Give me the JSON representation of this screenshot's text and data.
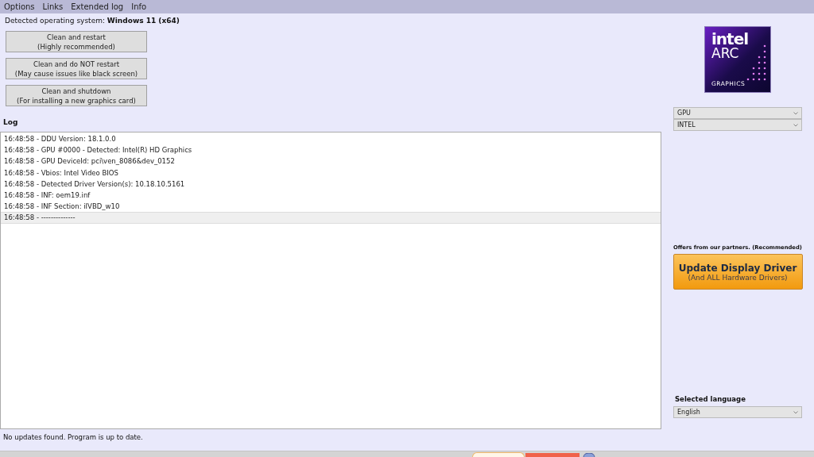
{
  "menu": [
    "Options",
    "Links",
    "Extended log",
    "Info"
  ],
  "os": {
    "label": "Detected operating system: ",
    "value": "Windows 11 (x64)"
  },
  "actions": [
    {
      "title": "Clean and restart",
      "subtitle": "(Highly recommended)"
    },
    {
      "title": "Clean and do NOT restart",
      "subtitle": "(May cause issues like black screen)"
    },
    {
      "title": "Clean and shutdown",
      "subtitle": "(For installing a new graphics card)"
    }
  ],
  "log": {
    "title": "Log",
    "rows": [
      {
        "text": "16:48:58 - DDU Version: 18.1.0.0",
        "selected": false
      },
      {
        "text": "16:48:58 - GPU #0000 - Detected: Intel(R) HD Graphics",
        "selected": false
      },
      {
        "text": "16:48:58 - GPU DeviceId: pci\\ven_8086&dev_0152",
        "selected": false
      },
      {
        "text": "16:48:58 - Vbios: Intel Video BIOS",
        "selected": false
      },
      {
        "text": "16:48:58 - Detected Driver Version(s): 10.18.10.5161",
        "selected": false
      },
      {
        "text": "16:48:58 - INF: oem19.inf",
        "selected": false
      },
      {
        "text": "16:48:58 - INF Section: iIVBD_w10",
        "selected": false
      },
      {
        "text": "16:48:58 - --------------",
        "selected": true
      }
    ]
  },
  "logo": {
    "line1": "intel",
    "line2": "ARC",
    "line3": "GRAPHICS"
  },
  "device_type": "GPU",
  "vendor": "INTEL",
  "offers": {
    "label": "Offers from our partners. (Recommended)",
    "title": "Update Display Driver",
    "subtitle": "(And ALL Hardware Drivers)"
  },
  "language": {
    "label": "Selected language",
    "value": "English"
  },
  "status": "No updates found. Program is up to date."
}
